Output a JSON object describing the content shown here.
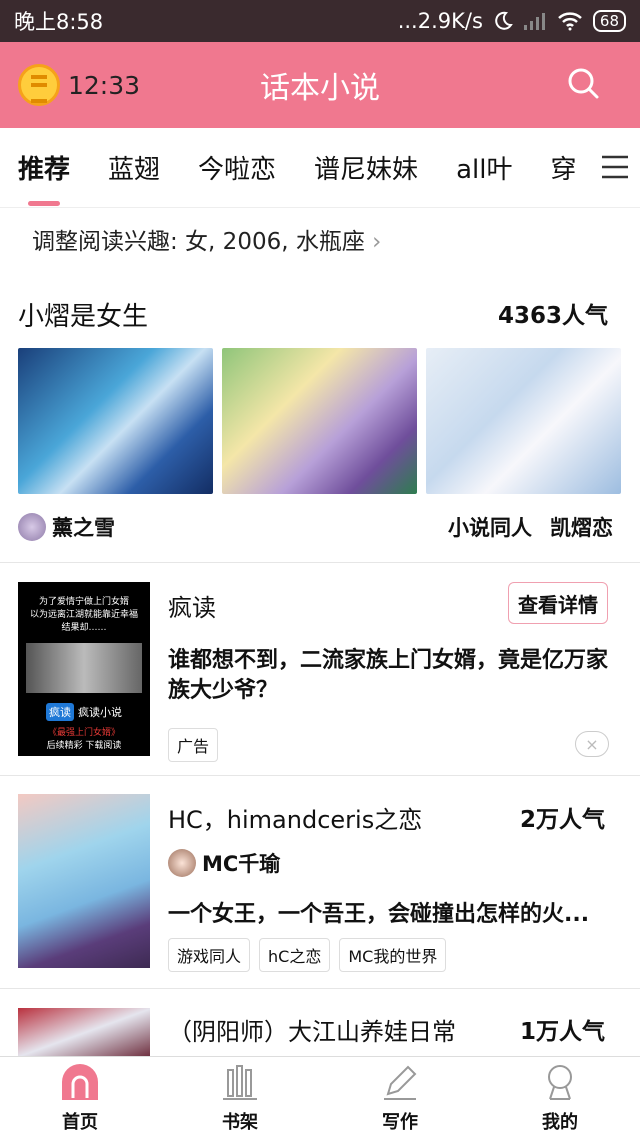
{
  "status_bar": {
    "time": "晚上8:58",
    "speed": "...2.9K/s",
    "battery": "68"
  },
  "app_bar": {
    "timer": "12:33",
    "title": "话本小说"
  },
  "tabs": [
    {
      "label": "推荐",
      "active": true
    },
    {
      "label": "蓝翅"
    },
    {
      "label": "今啦恋"
    },
    {
      "label": "谱尼妹妹"
    },
    {
      "label": "all叶"
    },
    {
      "label": "穿"
    }
  ],
  "interest": {
    "text": "调整阅读兴趣: 女, 2006, 水瓶座",
    "chevron": "›"
  },
  "featured": {
    "name": "小熠是女生",
    "popularity": "4363人气",
    "author": "薰之雪",
    "tags": [
      "小说同人",
      "凯熠恋"
    ]
  },
  "ad": {
    "image_lines": [
      "为了爱情宁做上门女婿",
      "以为远离江湖就能靠近幸福",
      "结果却……"
    ],
    "image_logo_badge": "疯读",
    "image_logo_text": "疯读小说",
    "image_red": "《最强上门女婿》",
    "image_footer": "后续精彩 下载阅读",
    "source": "疯读",
    "detail_button": "查看详情",
    "text": "谁都想不到，二流家族上门女婿，竟是亿万家族大少爷？",
    "tag": "广告",
    "close": "×"
  },
  "book1": {
    "title": "HC，himandceris之恋",
    "popularity": "2万人气",
    "author": "MC千瑜",
    "desc": "一个女王，一个吾王，会碰撞出怎样的火...",
    "tags": [
      "游戏同人",
      "hC之恋",
      "MC我的世界"
    ]
  },
  "book2": {
    "title": "（阴阳师）大江山养娃日常",
    "popularity": "1万人气"
  },
  "bottom_nav": [
    {
      "label": "首页",
      "icon": "home-icon",
      "active": true
    },
    {
      "label": "书架",
      "icon": "bookshelf-icon"
    },
    {
      "label": "写作",
      "icon": "pencil-icon"
    },
    {
      "label": "我的",
      "icon": "user-icon"
    }
  ],
  "colors": {
    "accent": "#f0788f",
    "status_bar": "#3a2a2e"
  }
}
